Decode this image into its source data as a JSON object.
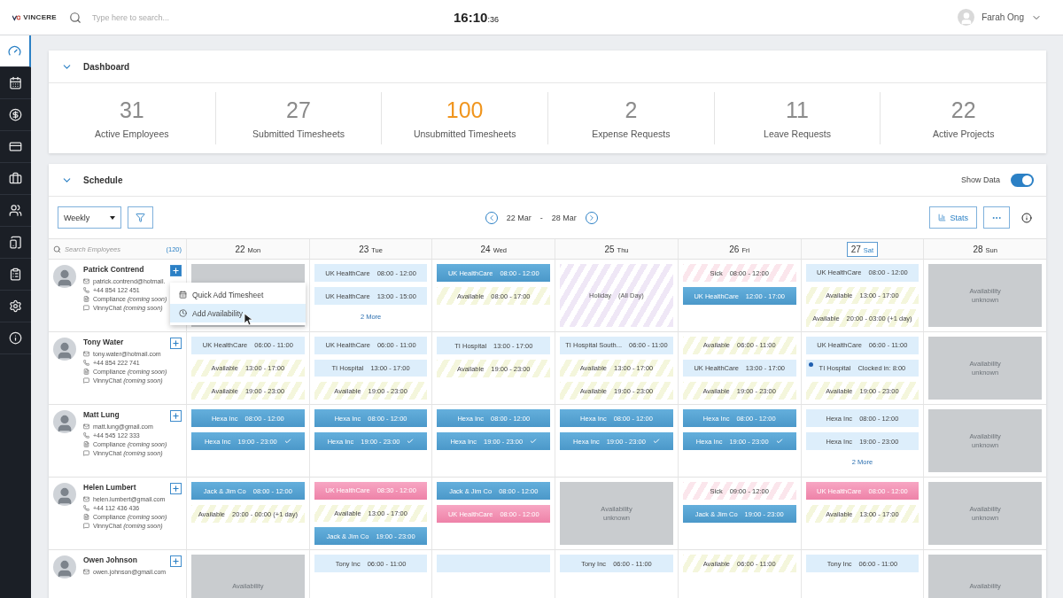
{
  "topbar": {
    "logo": "VINCERE",
    "search": {
      "placeholder": "Type here to search..."
    },
    "clock": {
      "main": "16:10",
      "seconds": ":36"
    },
    "user": "Farah Ong"
  },
  "sidebar": {
    "items": [
      {
        "selected": true
      },
      {
        "selected": false
      },
      {
        "selected": false
      },
      {
        "selected": false
      },
      {
        "selected": false
      },
      {
        "selected": false
      },
      {
        "selected": false
      },
      {
        "selected": false
      },
      {
        "selected": false
      },
      {
        "selected": false
      }
    ]
  },
  "dashboard": {
    "title": "Dashboard",
    "expanded": true,
    "stats": [
      {
        "value": "31",
        "label": "Active Employees",
        "highlighted": false
      },
      {
        "value": "27",
        "label": "Submitted Timesheets",
        "highlighted": false
      },
      {
        "value": "100",
        "label": "Unsubmitted Timesheets",
        "highlighted": true
      },
      {
        "value": "2",
        "label": "Expense Requests",
        "highlighted": false
      },
      {
        "value": "11",
        "label": "Leave Requests",
        "highlighted": false
      },
      {
        "value": "22",
        "label": "Active Projects",
        "highlighted": false
      }
    ]
  },
  "schedule": {
    "title": "Schedule",
    "expanded": true,
    "show_data": {
      "label": "Show Data",
      "on": true
    },
    "view": "Weekly",
    "range": {
      "from": "22 Mar",
      "separator": "-",
      "to": "28 Mar"
    },
    "stats_button": "Stats",
    "employee_search": {
      "placeholder": "Search Employees",
      "count": "(120)"
    },
    "days": [
      {
        "date": "22",
        "day": "Mon",
        "selected": false
      },
      {
        "date": "23",
        "day": "Tue",
        "selected": false
      },
      {
        "date": "24",
        "day": "Wed",
        "selected": false
      },
      {
        "date": "25",
        "day": "Thu",
        "selected": false
      },
      {
        "date": "26",
        "day": "Fri",
        "selected": false
      },
      {
        "date": "27",
        "day": "Sat",
        "selected": true
      },
      {
        "date": "28",
        "day": "Sun",
        "selected": false
      }
    ],
    "rows": [
      {
        "name": "Patrick Contrend",
        "email": "patrick.contrend@hotmail.",
        "phone": "+44 854 122 451",
        "compliance": "Compliance *(coming soon)*",
        "chat": "VinnyChat *(coming soon)*",
        "add_selected": true,
        "menu": [
          {
            "label": "Quick Add Timesheet",
            "selected": false
          },
          {
            "label": "Add Availability",
            "selected": true
          }
        ],
        "cells": [
          [
            {
              "kind": "unknown"
            }
          ],
          [
            {
              "kind": "pending",
              "label": "UK HealthCare",
              "time": "08:00 - 12:00"
            },
            {
              "kind": "pending",
              "label": "UK HealthCare",
              "time": "13:00 - 15:00"
            },
            {
              "kind": "more",
              "label": "2 More"
            }
          ],
          [
            {
              "kind": "booked",
              "label": "UK HealthCare",
              "time": "08:00 - 12:00"
            },
            {
              "kind": "available",
              "label": "Available",
              "time": "08:00 - 17:00"
            }
          ],
          [
            {
              "kind": "holiday",
              "label": "Holiday",
              "time": "(All Day)"
            }
          ],
          [
            {
              "kind": "sick",
              "label": "Sick",
              "time": "08:00 - 12:00"
            },
            {
              "kind": "booked",
              "label": "UK HealthCare",
              "time": "12:00 - 17:00"
            }
          ],
          [
            {
              "kind": "pending",
              "label": "UK HealthCare",
              "time": "08:00 - 12:00"
            },
            {
              "kind": "available",
              "label": "Available",
              "time": "13:00 - 17:00"
            },
            {
              "kind": "available",
              "label": "Available",
              "time": "20:00 - 03:00 (+1 day)"
            }
          ],
          [
            {
              "kind": "unknown",
              "label": "Availability unknown"
            }
          ]
        ]
      },
      {
        "name": "Tony Water",
        "email": "tony.water@hotmail.com",
        "phone": "+44 854 222 741",
        "compliance": "Compliance *(coming soon)*",
        "chat": "VinnyChat *(coming soon)*",
        "add_selected": false,
        "cells": [
          [
            {
              "kind": "pending",
              "label": "UK HealthCare",
              "time": "06:00 - 11:00"
            },
            {
              "kind": "available",
              "label": "Available",
              "time": "13:00 - 17:00"
            },
            {
              "kind": "available",
              "label": "Available",
              "time": "19:00 - 23:00"
            }
          ],
          [
            {
              "kind": "pending",
              "label": "UK HealthCare",
              "time": "06:00 - 11:00"
            },
            {
              "kind": "pending",
              "label": "TI Hospital",
              "time": "13:00 - 17:00"
            },
            {
              "kind": "available",
              "label": "Available",
              "time": "19:00 - 23:00"
            }
          ],
          [
            {
              "kind": "pending",
              "label": "TI Hospital",
              "time": "13:00 - 17:00"
            },
            {
              "kind": "available",
              "label": "Available",
              "time": "19:00 - 23:00"
            }
          ],
          [
            {
              "kind": "pending",
              "label": "TI Hospital South...",
              "time": "06:00 - 11:00"
            },
            {
              "kind": "available",
              "label": "Available",
              "time": "13:00 - 17:00"
            },
            {
              "kind": "available",
              "label": "Available",
              "time": "19:00 - 23:00"
            }
          ],
          [
            {
              "kind": "available",
              "label": "Available",
              "time": "06:00 - 11:00"
            },
            {
              "kind": "pending",
              "label": "UK HealthCare",
              "time": "13:00 - 17:00"
            },
            {
              "kind": "available",
              "label": "Available",
              "time": "19:00 - 23:00"
            }
          ],
          [
            {
              "kind": "pending",
              "label": "UK HealthCare",
              "time": "06:00 - 11:00"
            },
            {
              "kind": "pending",
              "label": "TI Hospital",
              "time": "Clocked in: 8:00",
              "color": "#1f5fb0"
            },
            {
              "kind": "available",
              "label": "Available",
              "time": "19:00 - 23:00"
            }
          ],
          [
            {
              "kind": "unknown",
              "label": "Availability unknown"
            }
          ]
        ]
      },
      {
        "name": "Matt Lung",
        "email": "matt.lung@gmail.com",
        "phone": "+44 545 122 333",
        "compliance": "Compliance *(coming soon)*",
        "chat": "VinnyChat *(coming soon)*",
        "add_selected": false,
        "cells": [
          [
            {
              "kind": "booked",
              "label": "Hexa Inc",
              "time": "08:00 - 12:00"
            },
            {
              "kind": "booked",
              "label": "Hexa Inc",
              "time": "19:00 - 23:00",
              "confirmed": true
            }
          ],
          [
            {
              "kind": "booked",
              "label": "Hexa Inc",
              "time": "08:00 - 12:00"
            },
            {
              "kind": "booked",
              "label": "Hexa Inc",
              "time": "19:00 - 23:00",
              "confirmed": true
            }
          ],
          [
            {
              "kind": "booked",
              "label": "Hexa Inc",
              "time": "08:00 - 12:00"
            },
            {
              "kind": "booked",
              "label": "Hexa Inc",
              "time": "19:00 - 23:00",
              "confirmed": true
            }
          ],
          [
            {
              "kind": "booked",
              "label": "Hexa Inc",
              "time": "08:00 - 12:00"
            },
            {
              "kind": "booked",
              "label": "Hexa Inc",
              "time": "19:00 - 23:00",
              "confirmed": true
            }
          ],
          [
            {
              "kind": "booked",
              "label": "Hexa Inc",
              "time": "08:00 - 12:00"
            },
            {
              "kind": "booked",
              "label": "Hexa Inc",
              "time": "19:00 - 23:00",
              "confirmed": true
            }
          ],
          [
            {
              "kind": "pending",
              "label": "Hexa Inc",
              "time": "08:00 - 12:00"
            },
            {
              "kind": "pending",
              "label": "Hexa Inc",
              "time": "19:00 - 23:00"
            },
            {
              "kind": "more",
              "label": "2 More"
            }
          ],
          [
            {
              "kind": "unknown",
              "label": "Availability unknown"
            }
          ]
        ]
      },
      {
        "name": "Helen Lumbert",
        "email": "helen.lumbert@gmail.com",
        "phone": "+44 112 436 436",
        "compliance": "Compliance *(coming soon)*",
        "chat": "VinnyChat *(coming soon)*",
        "add_selected": false,
        "cells": [
          [
            {
              "kind": "booked",
              "label": "Jack & Jim Co",
              "time": "08:00 - 12:00"
            },
            {
              "kind": "available",
              "label": "Available",
              "time": "20:00 - 00:00 (+1 day)"
            }
          ],
          [
            {
              "kind": "flagged",
              "label": "UK HealthCare",
              "time": "08:30 - 12:00"
            },
            {
              "kind": "available",
              "label": "Available",
              "time": "13:00 - 17:00"
            },
            {
              "kind": "booked",
              "label": "Jack & Jim Co",
              "time": "19:00 - 23:00"
            }
          ],
          [
            {
              "kind": "booked",
              "label": "Jack & Jim Co",
              "time": "08:00 - 12:00"
            },
            {
              "kind": "flagged",
              "label": "UK HealthCare",
              "time": "08:00 - 12:00"
            }
          ],
          [
            {
              "kind": "unknown",
              "label": "Availability unknown"
            }
          ],
          [
            {
              "kind": "sick",
              "label": "Sick",
              "time": "09:00 - 12:00"
            },
            {
              "kind": "booked",
              "label": "Jack & Jim Co",
              "time": "19:00 - 23:00"
            }
          ],
          [
            {
              "kind": "flagged",
              "label": "UK HealthCare",
              "time": "08:00 - 12:00"
            },
            {
              "kind": "available",
              "label": "Available",
              "time": "13:00 - 17:00"
            }
          ],
          [
            {
              "kind": "unknown",
              "label": "Availability unknown"
            }
          ]
        ]
      },
      {
        "name": "Owen Johnson",
        "email": "owen.johnson@gmail.com",
        "add_selected": false,
        "cells": [
          [
            {
              "kind": "unknown",
              "label": "Availability"
            }
          ],
          [
            {
              "kind": "pending",
              "label": "Tony Inc",
              "time": "06:00 - 11:00"
            }
          ],
          [
            {
              "kind": "pending"
            }
          ],
          [
            {
              "kind": "pending",
              "label": "Tony Inc",
              "time": "06:00 - 11:00"
            }
          ],
          [
            {
              "kind": "available",
              "label": "Available",
              "time": "06:00 - 11:00"
            }
          ],
          [
            {
              "kind": "pending",
              "label": "Tony Inc",
              "time": "06:00 - 11:00"
            }
          ],
          [
            {
              "kind": "unknown",
              "label": "Availability"
            }
          ]
        ]
      }
    ]
  }
}
